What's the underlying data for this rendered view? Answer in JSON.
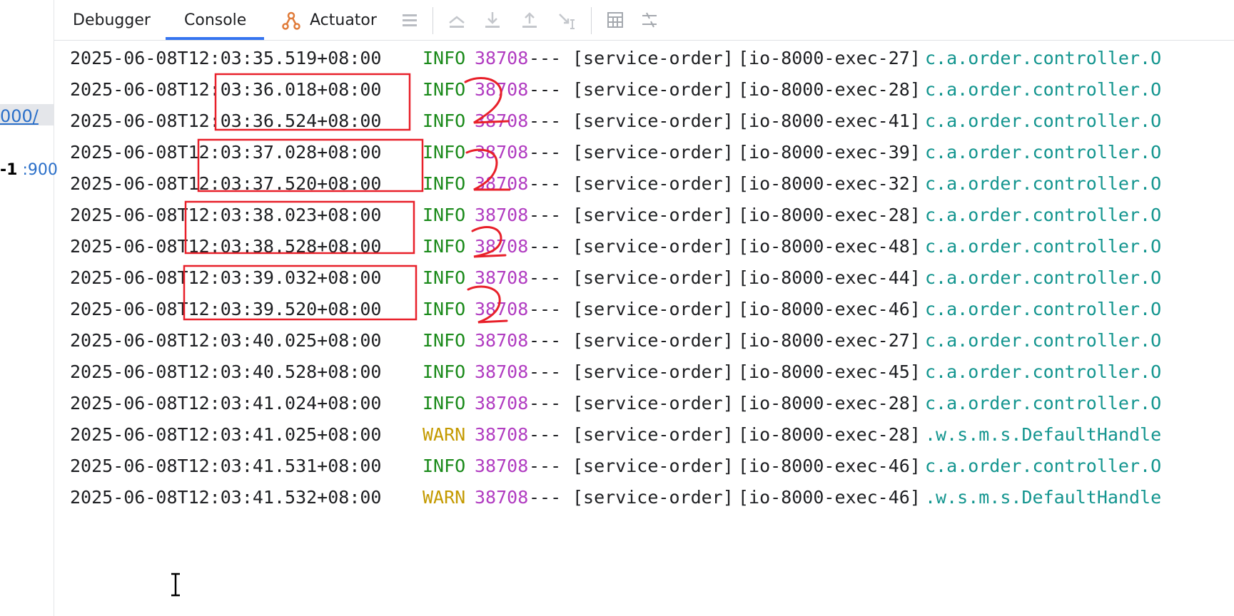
{
  "left_panel": {
    "link_text": "000/",
    "port_prefix": "-1",
    "port_text": ":900"
  },
  "toolbar": {
    "tabs": [
      {
        "label": "Debugger"
      },
      {
        "label": "Console"
      },
      {
        "label": "Actuator"
      }
    ],
    "active_tab": "Console"
  },
  "log_lines": [
    {
      "ts": "2025-06-08T12:03:35.519+08:00",
      "level": "INFO",
      "pid": "38708",
      "sep": "---",
      "app": "[service-order]",
      "thread": "[io-8000-exec-27]",
      "logger": "c.a.order.controller.O"
    },
    {
      "ts": "2025-06-08T12:03:36.018+08:00",
      "level": "INFO",
      "pid": "38708",
      "sep": "---",
      "app": "[service-order]",
      "thread": "[io-8000-exec-28]",
      "logger": "c.a.order.controller.O"
    },
    {
      "ts": "2025-06-08T12:03:36.524+08:00",
      "level": "INFO",
      "pid": "38708",
      "sep": "---",
      "app": "[service-order]",
      "thread": "[io-8000-exec-41]",
      "logger": "c.a.order.controller.O"
    },
    {
      "ts": "2025-06-08T12:03:37.028+08:00",
      "level": "INFO",
      "pid": "38708",
      "sep": "---",
      "app": "[service-order]",
      "thread": "[io-8000-exec-39]",
      "logger": "c.a.order.controller.O"
    },
    {
      "ts": "2025-06-08T12:03:37.520+08:00",
      "level": "INFO",
      "pid": "38708",
      "sep": "---",
      "app": "[service-order]",
      "thread": "[io-8000-exec-32]",
      "logger": "c.a.order.controller.O"
    },
    {
      "ts": "2025-06-08T12:03:38.023+08:00",
      "level": "INFO",
      "pid": "38708",
      "sep": "---",
      "app": "[service-order]",
      "thread": "[io-8000-exec-28]",
      "logger": "c.a.order.controller.O"
    },
    {
      "ts": "2025-06-08T12:03:38.528+08:00",
      "level": "INFO",
      "pid": "38708",
      "sep": "---",
      "app": "[service-order]",
      "thread": "[io-8000-exec-48]",
      "logger": "c.a.order.controller.O"
    },
    {
      "ts": "2025-06-08T12:03:39.032+08:00",
      "level": "INFO",
      "pid": "38708",
      "sep": "---",
      "app": "[service-order]",
      "thread": "[io-8000-exec-44]",
      "logger": "c.a.order.controller.O"
    },
    {
      "ts": "2025-06-08T12:03:39.520+08:00",
      "level": "INFO",
      "pid": "38708",
      "sep": "---",
      "app": "[service-order]",
      "thread": "[io-8000-exec-46]",
      "logger": "c.a.order.controller.O"
    },
    {
      "ts": "2025-06-08T12:03:40.025+08:00",
      "level": "INFO",
      "pid": "38708",
      "sep": "---",
      "app": "[service-order]",
      "thread": "[io-8000-exec-27]",
      "logger": "c.a.order.controller.O"
    },
    {
      "ts": "2025-06-08T12:03:40.528+08:00",
      "level": "INFO",
      "pid": "38708",
      "sep": "---",
      "app": "[service-order]",
      "thread": "[io-8000-exec-45]",
      "logger": "c.a.order.controller.O"
    },
    {
      "ts": "2025-06-08T12:03:41.024+08:00",
      "level": "INFO",
      "pid": "38708",
      "sep": "---",
      "app": "[service-order]",
      "thread": "[io-8000-exec-28]",
      "logger": "c.a.order.controller.O"
    },
    {
      "ts": "2025-06-08T12:03:41.025+08:00",
      "level": "WARN",
      "pid": "38708",
      "sep": "---",
      "app": "[service-order]",
      "thread": "[io-8000-exec-28]",
      "logger": ".w.s.m.s.DefaultHandle"
    },
    {
      "ts": "2025-06-08T12:03:41.531+08:00",
      "level": "INFO",
      "pid": "38708",
      "sep": "---",
      "app": "[service-order]",
      "thread": "[io-8000-exec-46]",
      "logger": "c.a.order.controller.O"
    },
    {
      "ts": "2025-06-08T12:03:41.532+08:00",
      "level": "WARN",
      "pid": "38708",
      "sep": "---",
      "app": "[service-order]",
      "thread": "[io-8000-exec-46]",
      "logger": ".w.s.m.s.DefaultHandle"
    }
  ],
  "annotations": {
    "handwritten_mark": "2",
    "color": "#e8202a"
  },
  "colors": {
    "info": "#1a8a1a",
    "warn": "#c49a00",
    "pid": "#b13cc1",
    "logger": "#13958f",
    "accent": "#3574f0"
  }
}
